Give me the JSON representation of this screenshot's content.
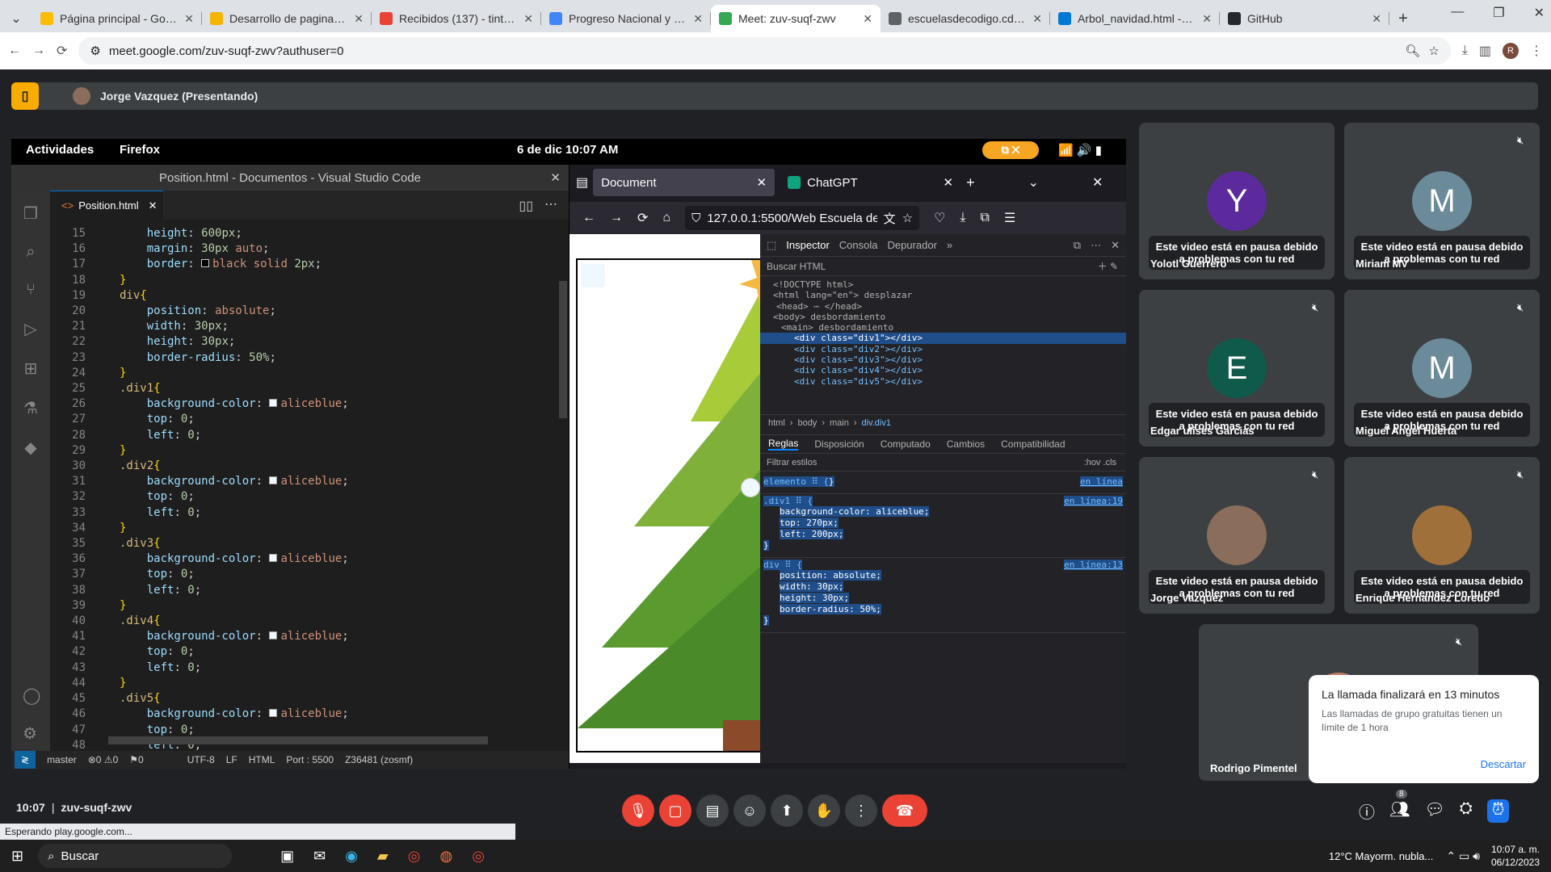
{
  "browser": {
    "tabs": [
      {
        "label": "Página principal - Google",
        "color": "#fbbc04"
      },
      {
        "label": "Desarrollo de paginas we",
        "color": "#f4b400"
      },
      {
        "label": "Recibidos (137) - tintaven",
        "color": "#ea4335"
      },
      {
        "label": "Progreso Nacional y Puer",
        "color": "#4285f4"
      },
      {
        "label": "Meet: zuv-suqf-zwv",
        "color": "#34a853",
        "active": true
      },
      {
        "label": "escuelasdecodigo.cdmx.g",
        "color": "#5f6368"
      },
      {
        "label": "Arbol_navidad.html - Áre",
        "color": "#0078d4"
      },
      {
        "label": "GitHub",
        "color": "#24292e"
      }
    ],
    "url": "meet.google.com/zuv-suqf-zwv?authuser=0",
    "status": "Esperando play.google.com..."
  },
  "meet": {
    "presenter": "Jorge Vazquez (Presentando)",
    "time": "10:07",
    "code": "zuv-suqf-zwv",
    "participants_count": "8",
    "pause_msg": "Este video está en pausa debido a problemas con tu red",
    "participants": [
      {
        "name": "Yolotl Guerrero",
        "initial": "Y",
        "color": "#5c2a9d"
      },
      {
        "name": "Miriam MV",
        "initial": "M",
        "color": "#6b8a9a"
      },
      {
        "name": "Edgar ulises Garcias",
        "initial": "E",
        "color": "#0f5a4a"
      },
      {
        "name": "Miguel Angel Huerta",
        "initial": "M",
        "color": "#6b8a9a"
      },
      {
        "name": "Jorge Vazquez",
        "initial": "",
        "color": "#8a6d5a"
      },
      {
        "name": "Enrique Hernandez Loredo",
        "initial": "",
        "color": "#a0703a"
      },
      {
        "name": "Rodrigo Pimentel",
        "initial": "",
        "color": "#c07a6a"
      }
    ],
    "toast": {
      "title": "La llamada finalizará en 13 minutos",
      "body": "Las llamadas de grupo gratuitas tienen un límite de 1 hora",
      "action": "Descartar"
    }
  },
  "shared": {
    "activities": "Actividades",
    "firefox": "Firefox",
    "date": "6 de dic  10:07 AM",
    "vscode_title": "Position.html - Documentos - Visual Studio Code",
    "file_tab": "Position.html",
    "status": {
      "branch": "master",
      "problems": "⊗0 ⚠0",
      "ports": "⚑0",
      "encoding": "UTF-8",
      "eol": "LF",
      "lang": "HTML",
      "port": "Port : 5500",
      "extra": "Z36481 (zosmf)"
    },
    "ff_tab1": "Document",
    "ff_tab2": "ChatGPT",
    "ff_url": "127.0.0.1:5500/Web Escuela de",
    "devtools": {
      "tabs": [
        "Inspector",
        "Consola",
        "Depurador"
      ],
      "search": "Buscar HTML",
      "tree": [
        "<!DOCTYPE html>",
        "<html lang=\"en\"> desplazar",
        "<head> ⋯ </head>",
        "<body> desbordamiento",
        "<main> desbordamiento",
        "<div class=\"div1\"></div>",
        "<div class=\"div2\"></div>",
        "<div class=\"div3\"></div>",
        "<div class=\"div4\"></div>",
        "<div class=\"div5\"></div>"
      ],
      "breadcrumb": [
        "html",
        "body",
        "main",
        "div.div1"
      ],
      "subtabs": [
        "Reglas",
        "Disposición",
        "Computado",
        "Cambios",
        "Compatibilidad"
      ],
      "filter": "Filtrar estilos",
      "rules_tools": ":hov  .cls",
      "rules": [
        {
          "sel": "elemento ⠿ {",
          "src": "en línea",
          "props": []
        },
        {
          "sel": ".div1 ⠿ {",
          "src": "en línea:19",
          "props": [
            "background-color: aliceblue;",
            "top: 270px;",
            "left: 200px;"
          ]
        },
        {
          "sel": "div ⠿ {",
          "src": "en línea:13",
          "props": [
            "position: absolute;",
            "width: 30px;",
            "height: 30px;",
            "border-radius: 50%;"
          ]
        }
      ]
    }
  },
  "code_lines": [
    {
      "n": "15",
      "html": "    <span class='prop'>height</span><span class='pun'>: </span><span class='num'>600px</span><span class='pun'>;</span>"
    },
    {
      "n": "16",
      "html": "    <span class='prop'>margin</span><span class='pun'>: </span><span class='num'>30px</span> <span class='val'>auto</span><span class='pun'>;</span>"
    },
    {
      "n": "17",
      "html": "    <span class='prop'>border</span><span class='pun'>: </span><span class='swb'></span><span class='val'>black solid</span> <span class='num'>2px</span><span class='pun'>;</span>"
    },
    {
      "n": "18",
      "html": "<span class='br'>}</span>"
    },
    {
      "n": "19",
      "html": "<span class='sel'>div</span><span class='br'>{</span>"
    },
    {
      "n": "20",
      "html": "    <span class='prop'>position</span><span class='pun'>: </span><span class='val'>absolute</span><span class='pun'>;</span>"
    },
    {
      "n": "21",
      "html": "    <span class='prop'>width</span><span class='pun'>: </span><span class='num'>30px</span><span class='pun'>;</span>"
    },
    {
      "n": "22",
      "html": "    <span class='prop'>height</span><span class='pun'>: </span><span class='num'>30px</span><span class='pun'>;</span>"
    },
    {
      "n": "23",
      "html": "    <span class='prop'>border-radius</span><span class='pun'>: </span><span class='num'>50%</span><span class='pun'>;</span>"
    },
    {
      "n": "24",
      "html": "<span class='br'>}</span>"
    },
    {
      "n": "25",
      "html": "<span class='sel'>.div1</span><span class='br'>{</span>"
    },
    {
      "n": "26",
      "html": "    <span class='prop'>background-color</span><span class='pun'>: </span><span class='sw'></span><span class='val'>aliceblue</span><span class='pun'>;</span>"
    },
    {
      "n": "27",
      "html": "    <span class='prop'>top</span><span class='pun'>: </span><span class='num'>0</span><span class='pun'>;</span>"
    },
    {
      "n": "28",
      "html": "    <span class='prop'>left</span><span class='pun'>: </span><span class='num'>0</span><span class='pun'>;</span>"
    },
    {
      "n": "29",
      "html": "<span class='br'>}</span>"
    },
    {
      "n": "30",
      "html": "<span class='sel'>.div2</span><span class='br'>{</span>"
    },
    {
      "n": "31",
      "html": "    <span class='prop'>background-color</span><span class='pun'>: </span><span class='sw'></span><span class='val'>aliceblue</span><span class='pun'>;</span>"
    },
    {
      "n": "32",
      "html": "    <span class='prop'>top</span><span class='pun'>: </span><span class='num'>0</span><span class='pun'>;</span>"
    },
    {
      "n": "33",
      "html": "    <span class='prop'>left</span><span class='pun'>: </span><span class='num'>0</span><span class='pun'>;</span>"
    },
    {
      "n": "34",
      "html": "<span class='br'>}</span>"
    },
    {
      "n": "35",
      "html": "<span class='sel'>.div3</span><span class='br'>{</span>"
    },
    {
      "n": "36",
      "html": "    <span class='prop'>background-color</span><span class='pun'>: </span><span class='sw'></span><span class='val'>aliceblue</span><span class='pun'>;</span>"
    },
    {
      "n": "37",
      "html": "    <span class='prop'>top</span><span class='pun'>: </span><span class='num'>0</span><span class='pun'>;</span>"
    },
    {
      "n": "38",
      "html": "    <span class='prop'>left</span><span class='pun'>: </span><span class='num'>0</span><span class='pun'>;</span>"
    },
    {
      "n": "39",
      "html": "<span class='br'>}</span>"
    },
    {
      "n": "40",
      "html": "<span class='sel'>.div4</span><span class='br'>{</span>"
    },
    {
      "n": "41",
      "html": "    <span class='prop'>background-color</span><span class='pun'>: </span><span class='sw'></span><span class='val'>aliceblue</span><span class='pun'>;</span>"
    },
    {
      "n": "42",
      "html": "    <span class='prop'>top</span><span class='pun'>: </span><span class='num'>0</span><span class='pun'>;</span>"
    },
    {
      "n": "43",
      "html": "    <span class='prop'>left</span><span class='pun'>: </span><span class='num'>0</span><span class='pun'>;</span>"
    },
    {
      "n": "44",
      "html": "<span class='br'>}</span>"
    },
    {
      "n": "45",
      "html": "<span class='sel'>.div5</span><span class='br'>{</span>"
    },
    {
      "n": "46",
      "html": "    <span class='prop'>background-color</span><span class='pun'>: </span><span class='sw'></span><span class='val'>aliceblue</span><span class='pun'>;</span>"
    },
    {
      "n": "47",
      "html": "    <span class='prop'>top</span><span class='pun'>: </span><span class='num'>0</span><span class='pun'>;</span>"
    },
    {
      "n": "48",
      "html": "    <span class='prop'>left</span><span class='pun'>: </span><span class='num'>0</span><span class='pun'>;</span>"
    }
  ],
  "taskbar": {
    "search": "Buscar",
    "weather": "12°C  Mayorm. nubla...",
    "time": "10:07 a. m.",
    "date": "06/12/2023"
  }
}
